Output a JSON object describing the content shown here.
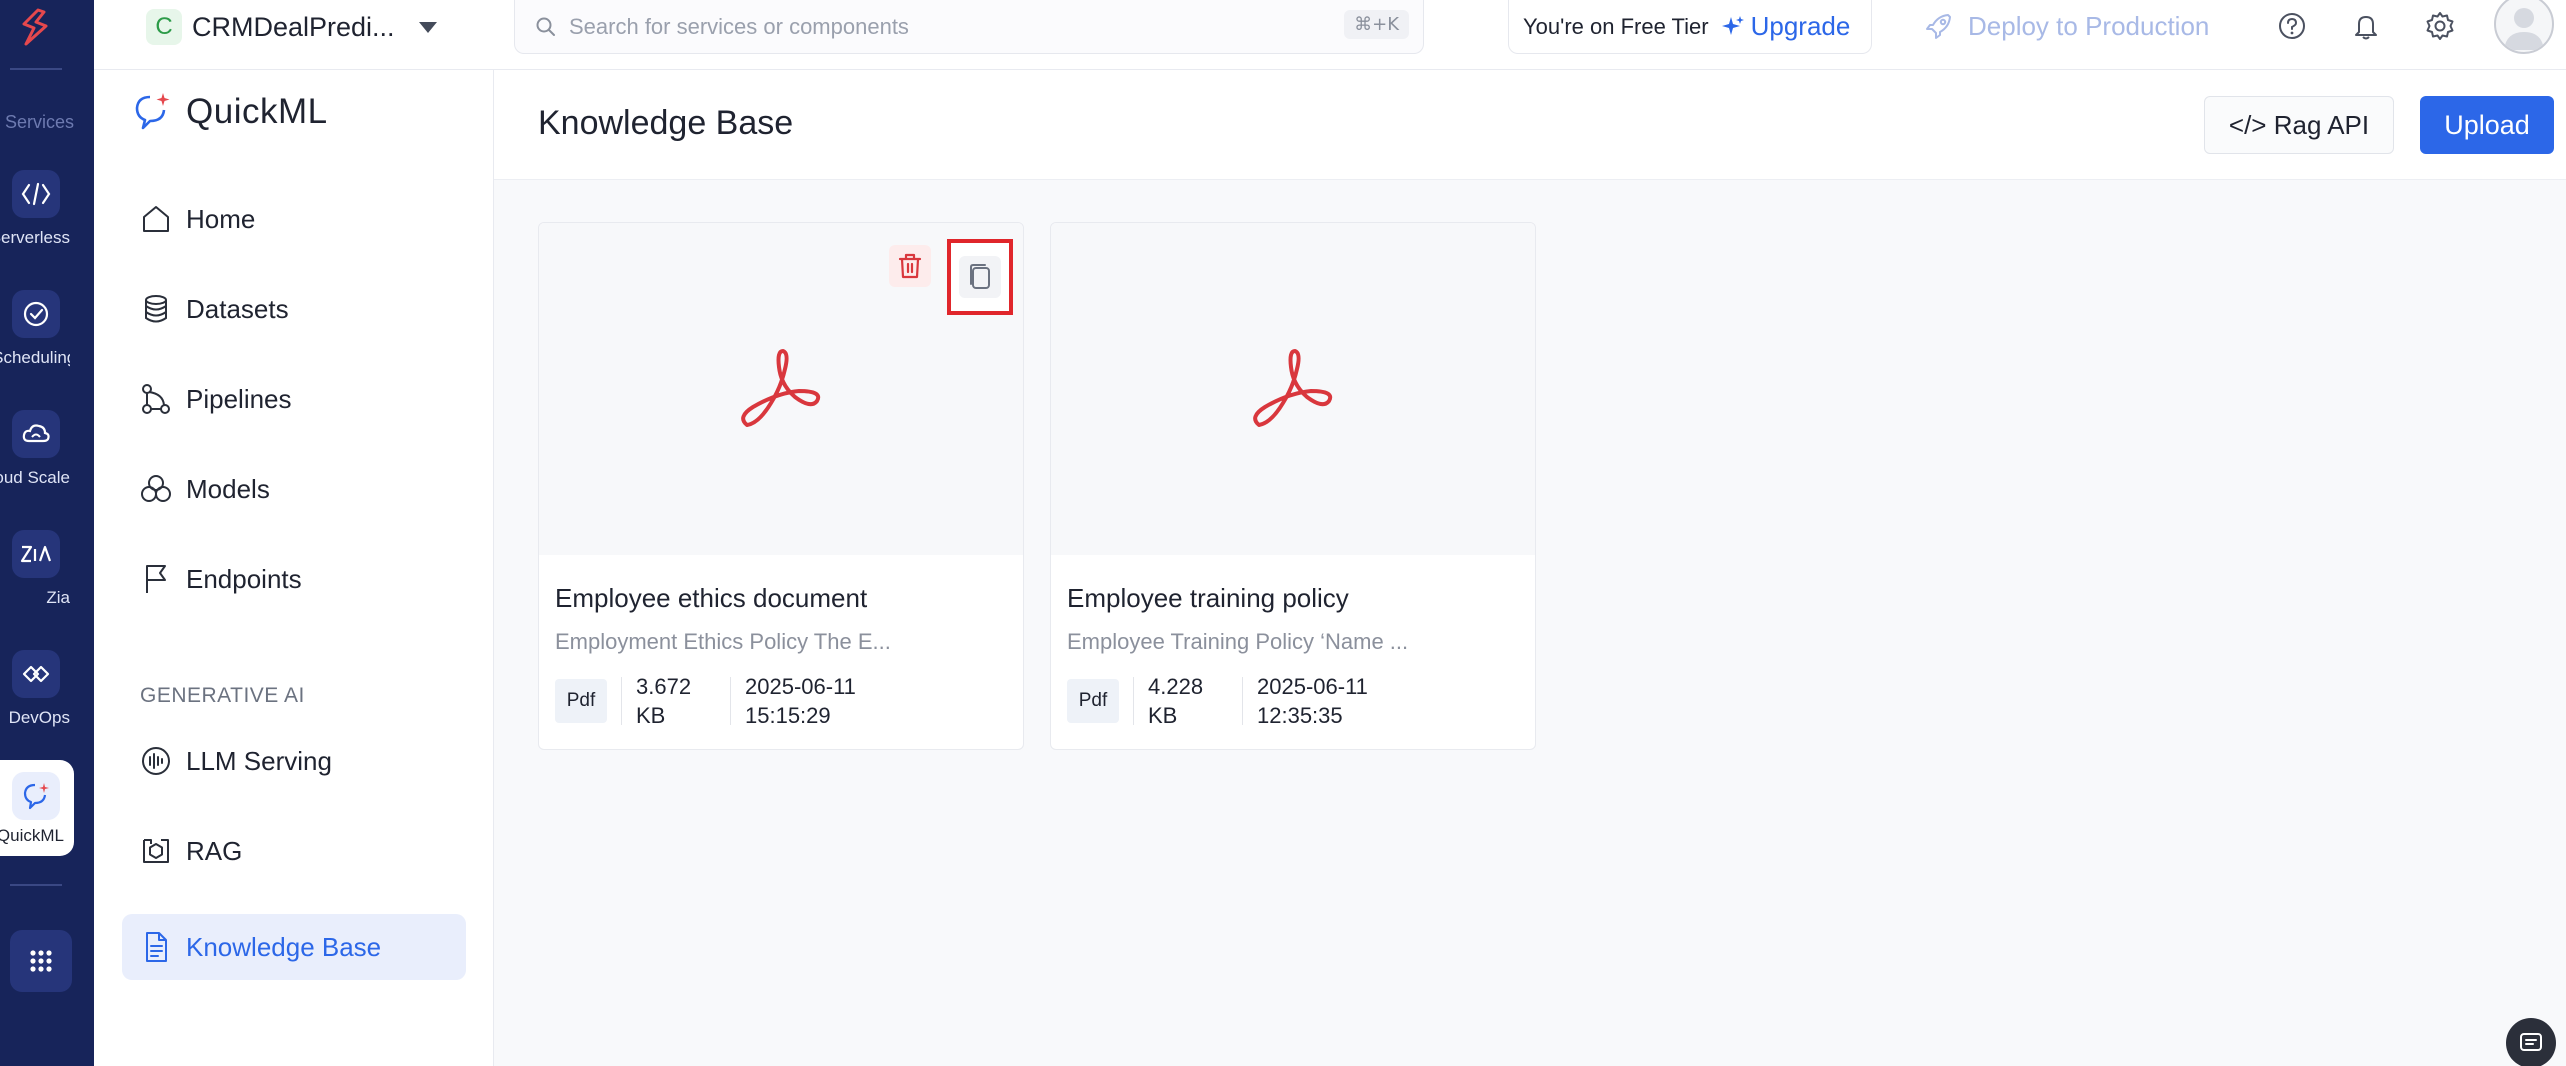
{
  "rail": {
    "services_label": "Services",
    "items": [
      {
        "label": "Serverless",
        "icon": "serverless-icon"
      },
      {
        "label": "Job Scheduling",
        "icon": "job-scheduling-icon"
      },
      {
        "label": "Cloud Scale",
        "icon": "cloud-scale-icon"
      },
      {
        "label": "Zia",
        "icon": "zia-icon"
      },
      {
        "label": "DevOps",
        "icon": "devops-icon"
      }
    ],
    "active_item": {
      "label": "QuickML",
      "icon": "quickml-icon"
    }
  },
  "topbar": {
    "project_initial": "C",
    "project_name": "CRMDealPredi...",
    "search_placeholder": "Search for services or components",
    "search_shortcut": "⌘+K",
    "tier_text": "You're on Free Tier",
    "upgrade_label": "Upgrade",
    "deploy_label": "Deploy to Production"
  },
  "sidebar": {
    "brand": "QuickML",
    "items": [
      {
        "label": "Home",
        "icon": "home-icon"
      },
      {
        "label": "Datasets",
        "icon": "database-icon"
      },
      {
        "label": "Pipelines",
        "icon": "pipeline-icon"
      },
      {
        "label": "Models",
        "icon": "models-icon"
      },
      {
        "label": "Endpoints",
        "icon": "flag-icon"
      }
    ],
    "section_label": "GENERATIVE AI",
    "gen_items": [
      {
        "label": "LLM Serving",
        "icon": "llm-serving-icon"
      },
      {
        "label": "RAG",
        "icon": "rag-icon"
      },
      {
        "label": "Knowledge Base",
        "icon": "document-icon",
        "active": true
      }
    ]
  },
  "main": {
    "title": "Knowledge Base",
    "rag_api_label": "</> Rag API",
    "upload_label": "Upload",
    "cards": [
      {
        "title": "Employee ethics document",
        "description": "Employment Ethics Policy The E...",
        "type": "Pdf",
        "size_value": "3.672",
        "size_unit": "KB",
        "date": "2025-06-11",
        "time": "15:15:29"
      },
      {
        "title": "Employee training policy",
        "description": "Employee Training Policy ‘Name ...",
        "type": "Pdf",
        "size_value": "4.228",
        "size_unit": "KB",
        "date": "2025-06-11",
        "time": "12:35:35"
      }
    ]
  },
  "colors": {
    "rail_bg": "#17245a",
    "accent": "#2c67e8",
    "pdf_red": "#d9373d",
    "highlight_red": "#e0262b"
  }
}
